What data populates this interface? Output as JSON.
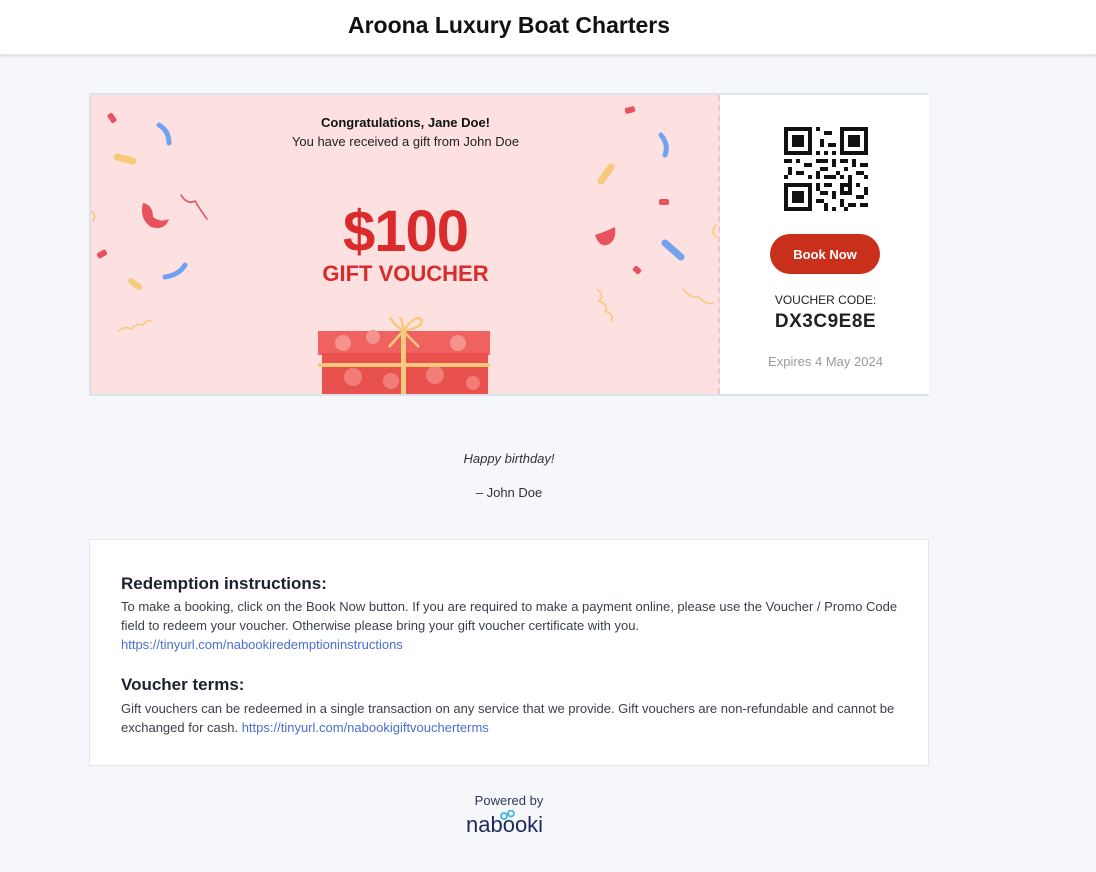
{
  "header": {
    "title": "Aroona Luxury Boat Charters"
  },
  "voucher": {
    "congrats": "Congratulations, Jane Doe!",
    "received": "You have received a gift from John Doe",
    "amount": "$100",
    "label": "GIFT VOUCHER",
    "book_button": "Book Now",
    "code_label": "VOUCHER CODE:",
    "code": "DX3C9E8E",
    "expires": "Expires 4 May 2024"
  },
  "message": {
    "text": "Happy birthday!",
    "signature": "– John Doe"
  },
  "terms": {
    "redemption_title": "Redemption instructions:",
    "redemption_text": "To make a booking, click on the Book Now button. If you are required to make a payment online, please use the Voucher / Promo Code field to redeem your voucher. Otherwise please bring your gift voucher certificate with you.",
    "redemption_link": "https://tinyurl.com/nabookiredemptioninstructions",
    "voucher_title": "Voucher terms:",
    "voucher_text": "Gift vouchers can be redeemed in a single transaction on any service that we provide. Gift vouchers are non-refundable and cannot be exchanged for cash.",
    "voucher_link": "https://tinyurl.com/nabookigiftvoucherterms"
  },
  "footer": {
    "powered_by": "Powered by",
    "brand": "nabooki"
  },
  "colors": {
    "accent_red": "#d92b2b",
    "button_red": "#c9301c",
    "voucher_bg": "#fde1e1",
    "link_blue": "#4b6ed1"
  },
  "icons": {
    "qr": "qr-code-icon",
    "gift": "gift-box-icon",
    "confetti": "confetti-decoration"
  }
}
